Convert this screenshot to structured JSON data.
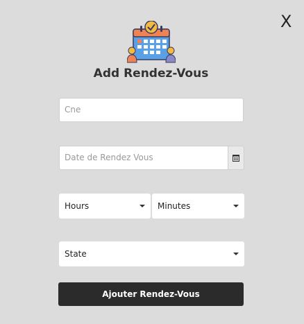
{
  "header": {
    "close_label": "X",
    "title": "Add Rendez-Vous"
  },
  "form": {
    "cne": {
      "placeholder": "Cne",
      "value": ""
    },
    "date": {
      "placeholder": "Date de Rendez Vous",
      "value": "",
      "icon": "calendar-icon"
    },
    "hours": {
      "selected": "Hours"
    },
    "minutes": {
      "selected": "Minutes"
    },
    "state": {
      "selected": "State"
    },
    "submit_label": "Ajouter Rendez-Vous"
  },
  "colors": {
    "background": "#dcdcdc",
    "button": "#2b2b2b",
    "calendar_header": "#ef8354",
    "calendar_body": "#4a90d9"
  }
}
